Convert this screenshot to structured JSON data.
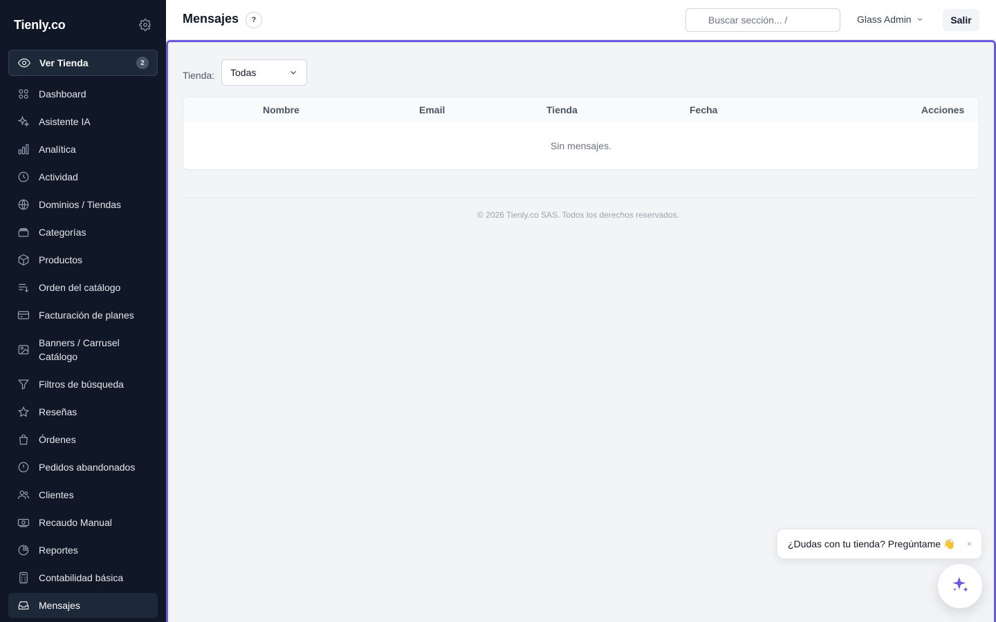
{
  "sidebar": {
    "brand": "Tienly.co",
    "ver_tienda": {
      "label": "Ver Tienda",
      "badge": "2"
    },
    "items": [
      {
        "label": "Dashboard",
        "icon": "grid-icon"
      },
      {
        "label": "Asistente IA",
        "icon": "sparkles-icon"
      },
      {
        "label": "Analítica",
        "icon": "bar-chart-icon"
      },
      {
        "label": "Actividad",
        "icon": "clock-icon"
      },
      {
        "label": "Dominios / Tiendas",
        "icon": "globe-icon"
      },
      {
        "label": "Categorías",
        "icon": "folder-stack-icon"
      },
      {
        "label": "Productos",
        "icon": "box-icon"
      },
      {
        "label": "Orden del catálogo",
        "icon": "sort-list-icon"
      },
      {
        "label": "Facturación de planes",
        "icon": "credit-card-icon"
      },
      {
        "label": "Banners / Carrusel Catálogo",
        "icon": "image-icon"
      },
      {
        "label": "Filtros de búsqueda",
        "icon": "filter-icon"
      },
      {
        "label": "Reseñas",
        "icon": "star-icon"
      },
      {
        "label": "Órdenes",
        "icon": "shopping-bag-icon"
      },
      {
        "label": "Pedidos abandonados",
        "icon": "alert-circle-icon"
      },
      {
        "label": "Clientes",
        "icon": "users-icon"
      },
      {
        "label": "Recaudo Manual",
        "icon": "cash-icon"
      },
      {
        "label": "Reportes",
        "icon": "pie-chart-icon"
      },
      {
        "label": "Contabilidad básica",
        "icon": "calculator-icon"
      },
      {
        "label": "Mensajes",
        "icon": "inbox-icon"
      }
    ],
    "active_item": "Mensajes"
  },
  "header": {
    "title": "Mensajes",
    "help_label": "?",
    "search_placeholder": "Buscar sección...  /",
    "user": "Glass Admin",
    "logout": "Salir"
  },
  "filter": {
    "label": "Tienda:",
    "selected": "Todas"
  },
  "table": {
    "columns": [
      "Nombre",
      "Email",
      "Tienda",
      "Fecha",
      "Acciones"
    ],
    "empty_message": "Sin mensajes."
  },
  "footer": {
    "text": "© 2026 Tienly.co SAS. Todos los derechos reservados."
  },
  "chat": {
    "prompt": "¿Dudas con tu tienda? Pregúntame 👋",
    "close": "×"
  },
  "colors": {
    "sidebar_bg": "#101828",
    "accent": "#6a5ae0",
    "page_bg": "#f3f4f6"
  }
}
